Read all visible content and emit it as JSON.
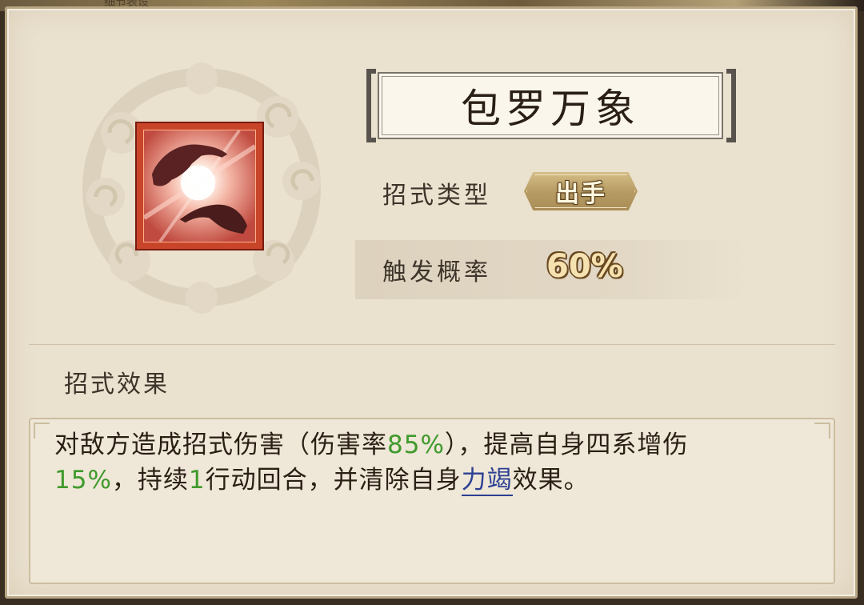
{
  "top_strip": {
    "text": "细节表设"
  },
  "skill": {
    "name": "包罗万象",
    "type_label": "招式类型",
    "type_value": "出手",
    "prob_label": "触发概率",
    "prob_value": "60%"
  },
  "effect": {
    "section_label": "招式效果",
    "text_p1": "对敌方造成招式伤害（伤害率",
    "rate": "85%",
    "text_p2": "），提高自身四系增伤",
    "boost": "15%",
    "text_p3": "，持续",
    "duration": "1",
    "text_p4": "行动回合，并清除自身",
    "link": "力竭",
    "text_p5": "效果。"
  },
  "colors": {
    "panel_bg": "#eae1cf",
    "accent_green": "#3f9a2c",
    "link_blue": "#2b3f93",
    "icon_red": "#c8452a"
  },
  "icons": {
    "skill_icon": "hands-energy-orb-icon",
    "emblem": "cloud-swirl-emblem-icon"
  }
}
